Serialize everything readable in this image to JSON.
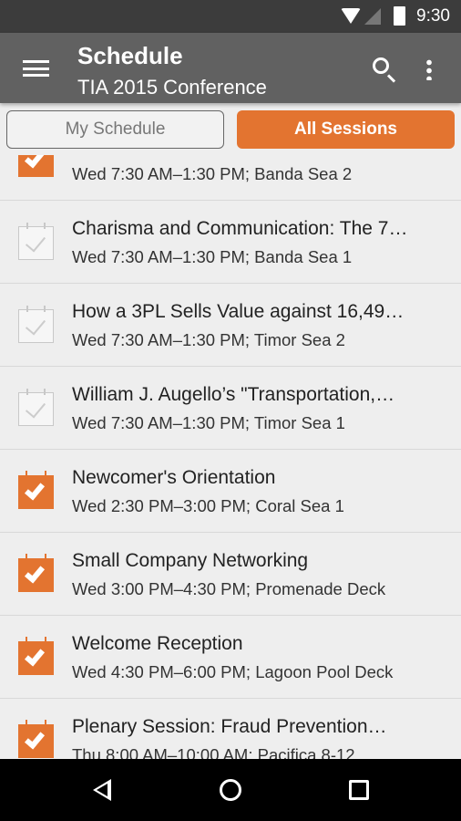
{
  "status_bar": {
    "time": "9:30"
  },
  "toolbar": {
    "title": "Schedule",
    "subtitle": "TIA 2015 Conference"
  },
  "tabs": [
    {
      "label": "My Schedule",
      "active": false
    },
    {
      "label": "All Sessions",
      "active": true
    }
  ],
  "accent_color": "#e37430",
  "sessions": [
    {
      "title": "",
      "subtitle": "Wed 7:30 AM–1:30 PM; Banda Sea 2",
      "in_schedule": true
    },
    {
      "title": "Charisma and Communication: The 7…",
      "subtitle": "Wed 7:30 AM–1:30 PM; Banda Sea 1",
      "in_schedule": false
    },
    {
      "title": "How a 3PL Sells Value against 16,49…",
      "subtitle": "Wed 7:30 AM–1:30 PM; Timor Sea 2",
      "in_schedule": false
    },
    {
      "title": "William J. Augello’s \"Transportation,…",
      "subtitle": "Wed 7:30 AM–1:30 PM; Timor Sea 1",
      "in_schedule": false
    },
    {
      "title": "Newcomer's Orientation",
      "subtitle": "Wed 2:30 PM–3:00 PM; Coral Sea 1",
      "in_schedule": true
    },
    {
      "title": "Small Company Networking",
      "subtitle": "Wed 3:00 PM–4:30 PM; Promenade Deck",
      "in_schedule": true
    },
    {
      "title": "Welcome Reception",
      "subtitle": "Wed 4:30 PM–6:00 PM; Lagoon Pool Deck",
      "in_schedule": true
    },
    {
      "title": "Plenary Session: Fraud Prevention…",
      "subtitle": "Thu 8:00 AM–10:00 AM; Pacifica 8-12",
      "in_schedule": true
    }
  ]
}
